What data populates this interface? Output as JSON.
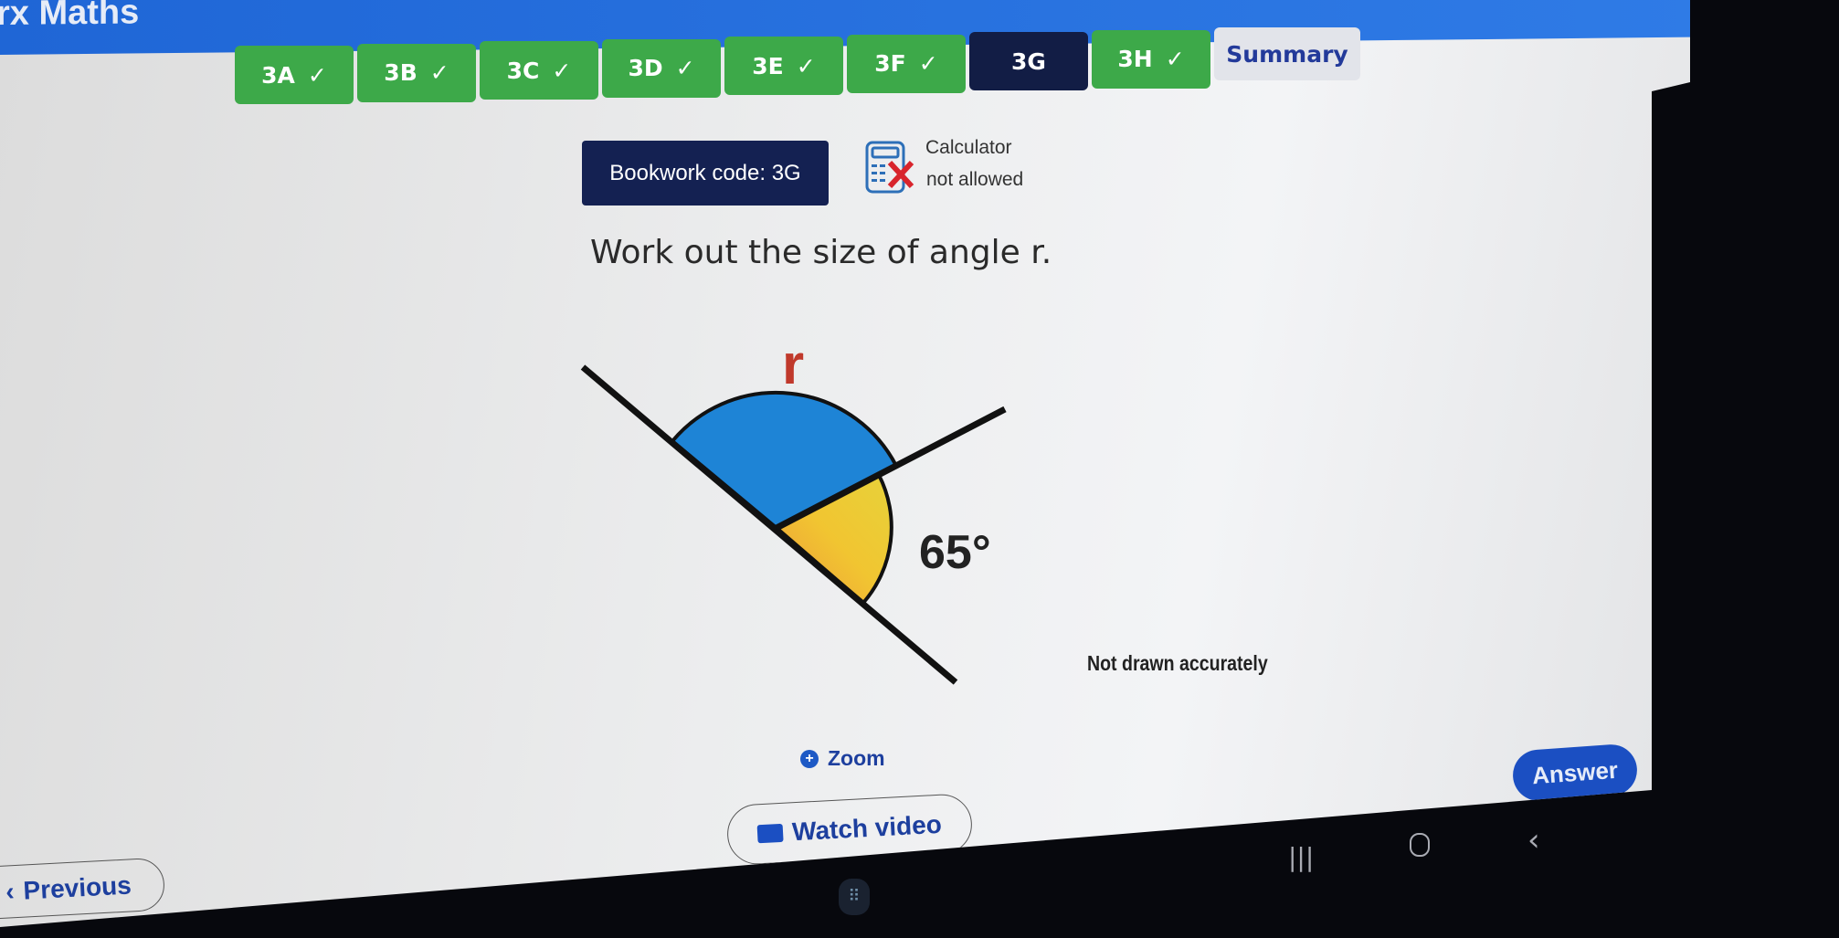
{
  "app": {
    "title": "rx Maths"
  },
  "tabs": [
    {
      "label": "3A",
      "done": true
    },
    {
      "label": "3B",
      "done": true
    },
    {
      "label": "3C",
      "done": true
    },
    {
      "label": "3D",
      "done": true
    },
    {
      "label": "3E",
      "done": true
    },
    {
      "label": "3F",
      "done": true
    },
    {
      "label": "3G",
      "done": false,
      "active": true
    },
    {
      "label": "3H",
      "done": true
    },
    {
      "label": "Summary",
      "done": false
    }
  ],
  "check_glyph": "✓",
  "bookwork": {
    "label": "Bookwork code: 3G"
  },
  "calculator": {
    "icon": "calculator-crossed-icon",
    "line1": "Calculator",
    "line2": "not allowed"
  },
  "question": {
    "text": "Work out the size of angle r."
  },
  "diagram": {
    "unknown_label": "r",
    "known_angle": "65°",
    "note": "Not drawn accurately",
    "colors": {
      "unknown": "#1e84d6",
      "known": "#f0c22c",
      "label_r": "#c0392b"
    }
  },
  "actions": {
    "zoom": "Zoom",
    "answer": "Answer",
    "watch_video": "Watch video",
    "previous": "Previous"
  },
  "colors": {
    "header": "#2f7be6",
    "tab_done": "#3da949",
    "tab_active": "#121d45",
    "link": "#1d3f9e"
  }
}
